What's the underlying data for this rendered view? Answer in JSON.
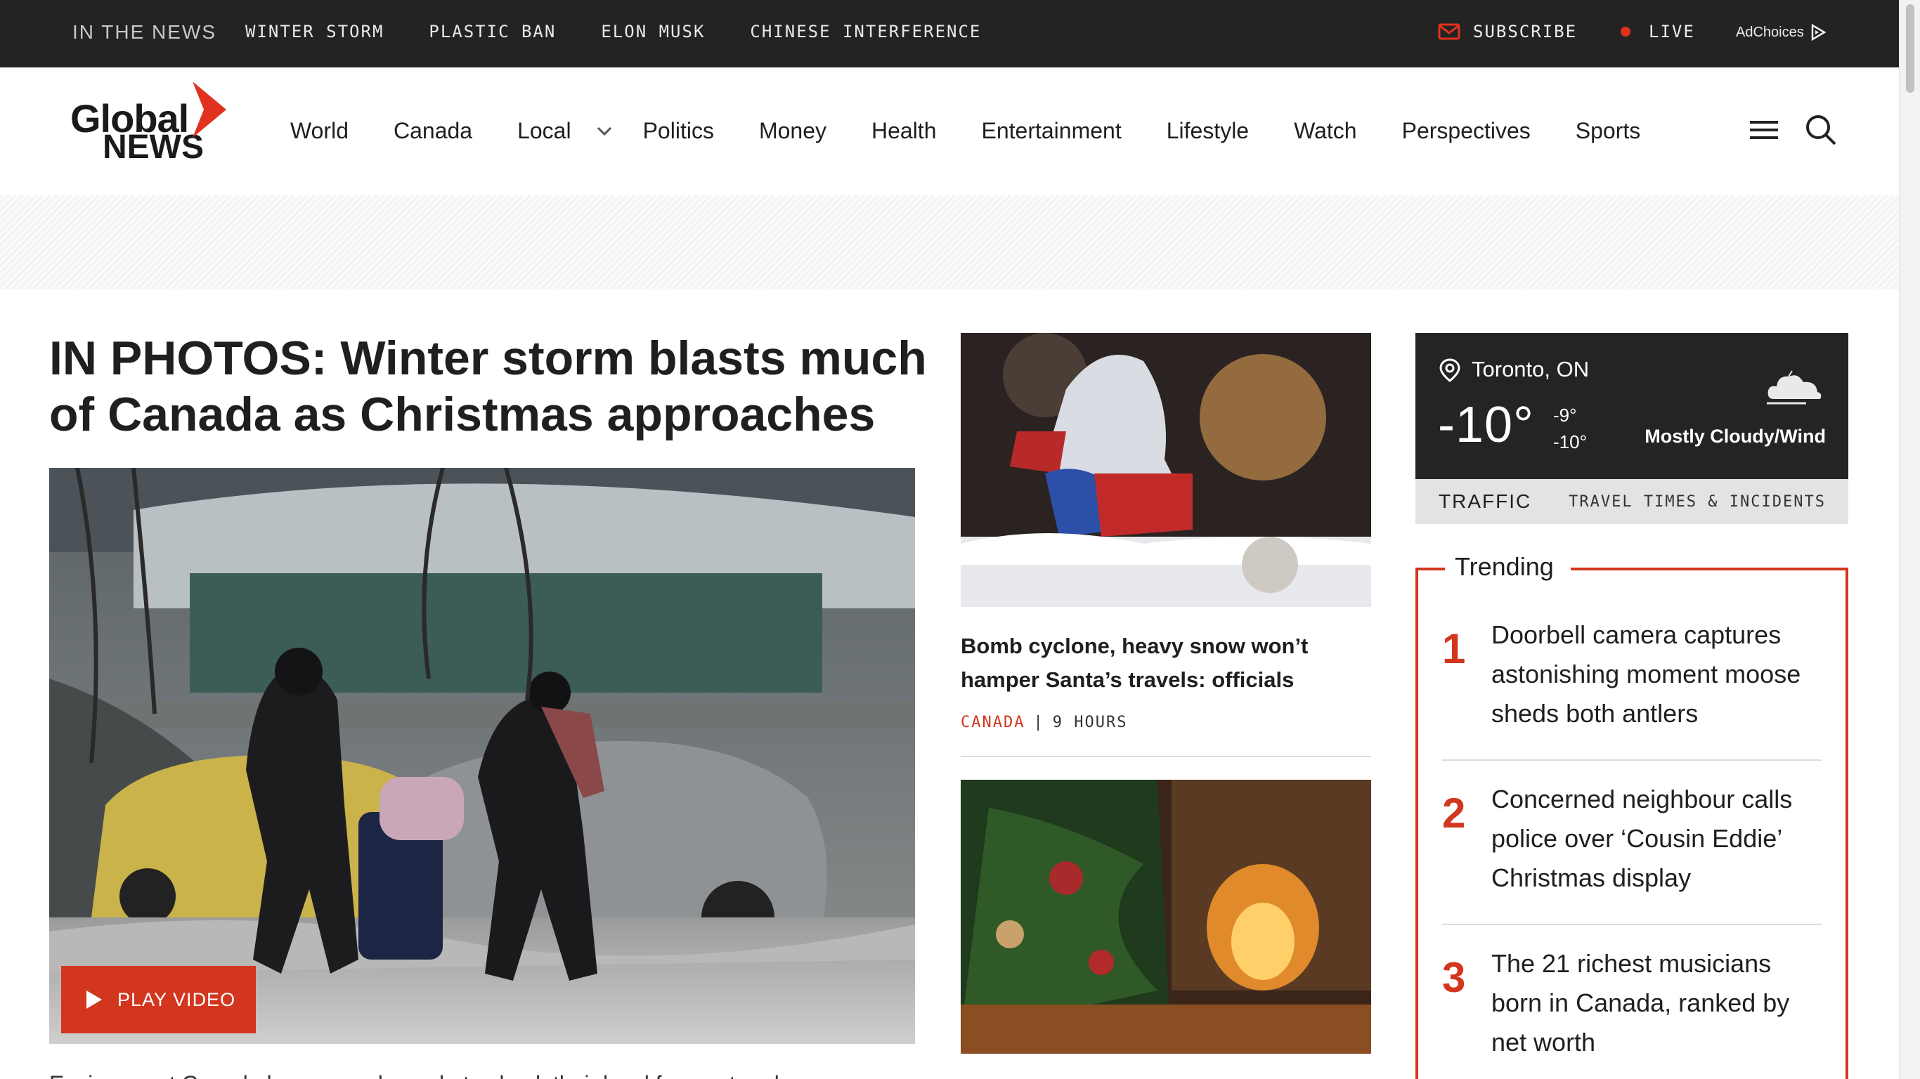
{
  "topbar": {
    "in_the_news": "IN THE NEWS",
    "topics": [
      "WINTER STORM",
      "PLASTIC BAN",
      "ELON MUSK",
      "CHINESE INTERFERENCE"
    ],
    "subscribe": "SUBSCRIBE",
    "live": "LIVE",
    "adchoices": "AdChoices"
  },
  "logo": {
    "line1": "Global",
    "line2": "NEWS"
  },
  "nav": {
    "items": [
      "World",
      "Canada",
      "Local",
      "Politics",
      "Money",
      "Health",
      "Entertainment",
      "Lifestyle",
      "Watch",
      "Perspectives",
      "Sports"
    ]
  },
  "lead": {
    "title": "IN PHOTOS: Winter storm blasts much of Canada as Christmas approaches",
    "play_label": "PLAY VIDEO",
    "excerpt": "Environment Canada has warned people to check their local forecast and"
  },
  "stories": [
    {
      "title": "Bomb cyclone, heavy snow won’t hamper Santa’s travels: officials",
      "category": "CANADA",
      "age": "9 HOURS"
    }
  ],
  "weather": {
    "city": "Toronto, ON",
    "temp": "-10°",
    "high": "-9°",
    "low": "-10°",
    "condition": "Mostly Cloudy/Wind",
    "traffic_label": "TRAFFIC",
    "traffic_sub": "TRAVEL TIMES & INCIDENTS"
  },
  "trending": {
    "title": "Trending",
    "items": [
      {
        "num": "1",
        "text": "Doorbell camera captures astonishing moment moose sheds both antlers"
      },
      {
        "num": "2",
        "text": "Concerned neighbour calls police over ‘Cousin Eddie’ Christmas display"
      },
      {
        "num": "3",
        "text": "The 21 richest musicians born in Canada, ranked by net worth"
      }
    ]
  },
  "colors": {
    "accent": "#d3361f",
    "topbar": "#232323",
    "weather_bg": "#242424"
  }
}
